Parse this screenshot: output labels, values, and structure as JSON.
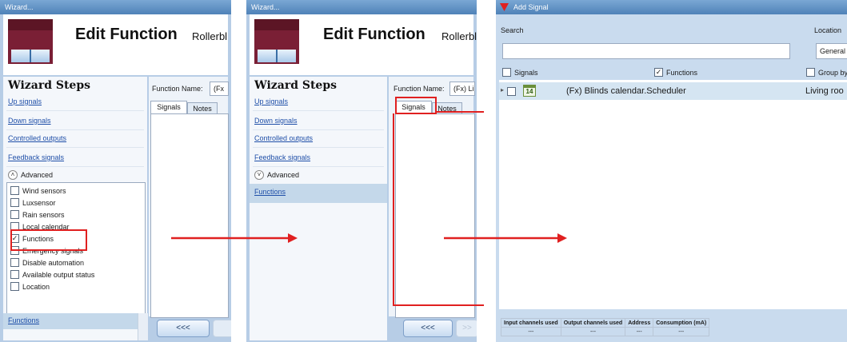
{
  "panel1": {
    "title": "Wizard...",
    "edit_title": "Edit Function",
    "function_type": "Rollerbl",
    "steps_heading": "Wizard Steps",
    "steps": [
      "Up signals",
      "Down signals",
      "Controlled outputs",
      "Feedback signals"
    ],
    "advanced_label": "Advanced",
    "advanced_items": [
      {
        "label": "Wind sensors",
        "checked": false
      },
      {
        "label": "Luxsensor",
        "checked": false
      },
      {
        "label": "Rain sensors",
        "checked": false
      },
      {
        "label": "Local calendar",
        "checked": false
      },
      {
        "label": "Functions",
        "checked": true
      },
      {
        "label": "Emergency signals",
        "checked": false
      },
      {
        "label": "Disable automation",
        "checked": false
      },
      {
        "label": "Available output status",
        "checked": false
      },
      {
        "label": "Location",
        "checked": false
      }
    ],
    "selected_step": "Functions",
    "back_button": "<<<",
    "function_name_label": "Function Name:",
    "function_name_value": "(Fx",
    "tabs": [
      "Signals",
      "Notes"
    ]
  },
  "panel2": {
    "title": "Wizard...",
    "edit_title": "Edit Function",
    "function_type": "Rollerbli",
    "steps_heading": "Wizard Steps",
    "steps": [
      "Up signals",
      "Down signals",
      "Controlled outputs",
      "Feedback signals"
    ],
    "advanced_label": "Advanced",
    "selected_step": "Functions",
    "back_button": "<<<",
    "next_button": ">>",
    "function_name_label": "Function Name:",
    "function_name_value": "(Fx) Li",
    "tabs": [
      "Signals",
      "Notes"
    ]
  },
  "panel3": {
    "title": "Add Signal",
    "search_label": "Search",
    "location_label": "Location",
    "location_value": "General",
    "filter_signals": {
      "label": "Signals",
      "checked": false
    },
    "filter_functions": {
      "label": "Functions",
      "checked": true
    },
    "filter_group": {
      "label": "Group by",
      "checked": false
    },
    "result": {
      "icon_text": "14",
      "name": "(Fx) Blinds calendar.Scheduler",
      "location": "Living roo"
    },
    "footer_headers": [
      "Input channels used",
      "Output channels used",
      "Address",
      "Consumption (mA)"
    ],
    "footer_values": [
      "---",
      "---",
      "---",
      "---"
    ]
  },
  "colors": {
    "frame": "#b7cde6",
    "accent_red": "#e02020",
    "link": "#1f4fa8",
    "selection": "#c4d8ea"
  }
}
